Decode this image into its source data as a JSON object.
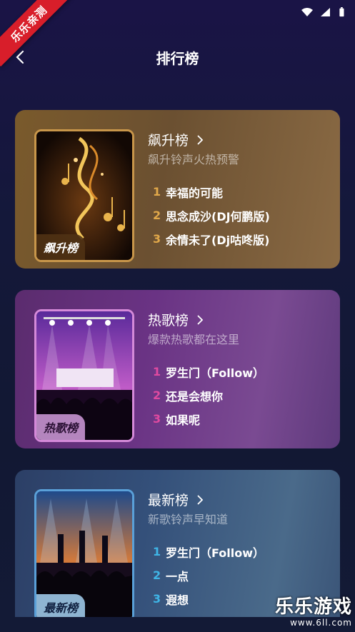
{
  "status": {
    "icons": [
      "wifi-icon",
      "signal-icon",
      "battery-icon"
    ]
  },
  "ribbon": {
    "text": "乐乐亲测"
  },
  "header": {
    "title": "排行榜",
    "back_icon": "chevron-left-icon"
  },
  "charts": [
    {
      "title": "飙升榜",
      "subtitle": "飙升铃声火热预警",
      "cover_label": "飙升榜",
      "items": [
        {
          "rank": "1",
          "name": "幸福的可能"
        },
        {
          "rank": "2",
          "name": "思念成沙(DJ何鹏版)"
        },
        {
          "rank": "3",
          "name": "余情未了(Dj咕咚版)"
        }
      ]
    },
    {
      "title": "热歌榜",
      "subtitle": "爆款热歌都在这里",
      "cover_label": "热歌榜",
      "items": [
        {
          "rank": "1",
          "name": "罗生门（Follow）"
        },
        {
          "rank": "2",
          "name": "还是会想你"
        },
        {
          "rank": "3",
          "name": "如果呢"
        }
      ]
    },
    {
      "title": "最新榜",
      "subtitle": "新歌铃声早知道",
      "cover_label": "最新榜",
      "items": [
        {
          "rank": "1",
          "name": "罗生门（Follow）"
        },
        {
          "rank": "2",
          "name": "一点"
        },
        {
          "rank": "3",
          "name": "遐想"
        }
      ]
    }
  ],
  "watermark": {
    "title": "乐乐游戏",
    "url": "www.6ll.com"
  },
  "colors": {
    "gold": "#e1a84a",
    "pink": "#e04aa0",
    "blue": "#3fb5e6"
  }
}
